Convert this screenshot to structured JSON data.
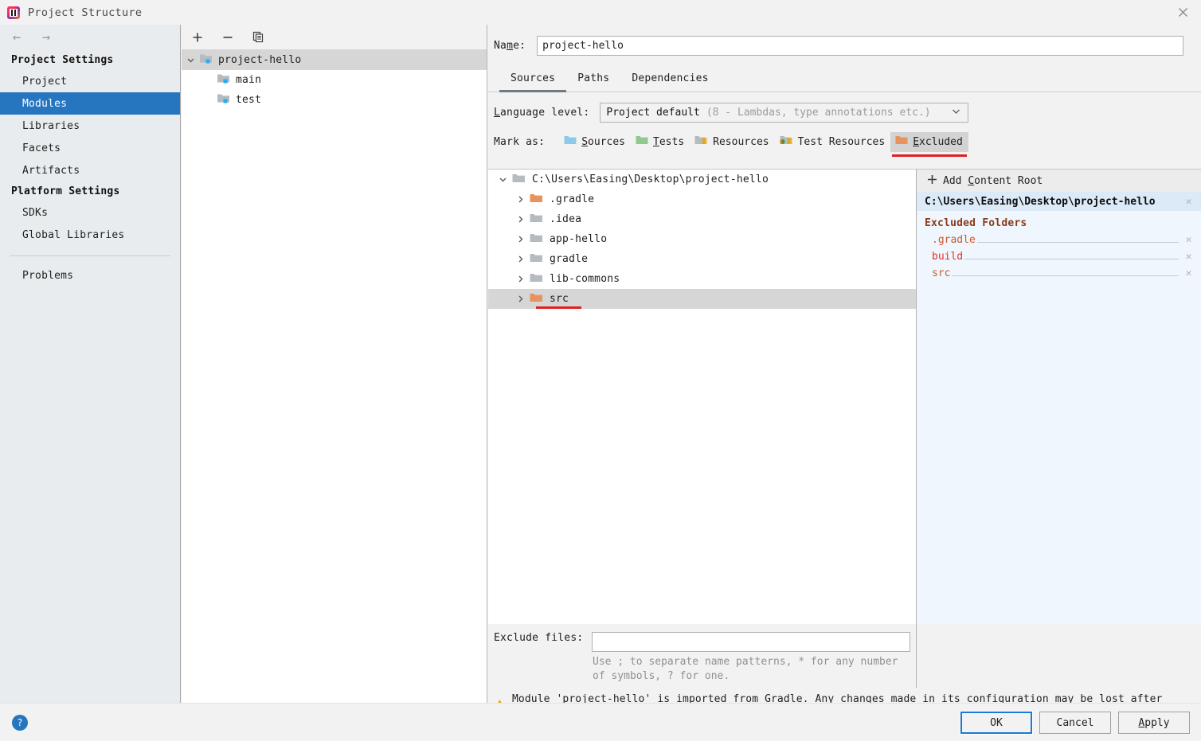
{
  "window": {
    "title": "Project Structure",
    "logo_icon": "intellij-idea-logo",
    "close_icon": "close-icon"
  },
  "sidebar": {
    "back_icon": "arrow-left-icon",
    "forward_icon": "arrow-right-icon",
    "groups": [
      {
        "title": "Project Settings",
        "items": [
          {
            "label": "Project",
            "selected": false
          },
          {
            "label": "Modules",
            "selected": true
          },
          {
            "label": "Libraries",
            "selected": false
          },
          {
            "label": "Facets",
            "selected": false
          },
          {
            "label": "Artifacts",
            "selected": false
          }
        ]
      },
      {
        "title": "Platform Settings",
        "items": [
          {
            "label": "SDKs",
            "selected": false
          },
          {
            "label": "Global Libraries",
            "selected": false
          }
        ]
      }
    ],
    "problems_label": "Problems"
  },
  "module_panel": {
    "toolbar": {
      "add_icon": "plus-icon",
      "remove_icon": "minus-icon",
      "copy_icon": "copy-icon"
    },
    "tree": [
      {
        "label": "project-hello",
        "level": 0,
        "expanded": true,
        "selected": true,
        "icon": "module-folder-icon"
      },
      {
        "label": "main",
        "level": 1,
        "expanded": false,
        "selected": false,
        "icon": "module-folder-icon"
      },
      {
        "label": "test",
        "level": 1,
        "expanded": false,
        "selected": false,
        "icon": "module-folder-icon"
      }
    ]
  },
  "detail": {
    "name_label": "Name:",
    "name_value": "project-hello",
    "tabs": [
      {
        "label": "Sources",
        "active": true
      },
      {
        "label": "Paths",
        "active": false
      },
      {
        "label": "Dependencies",
        "active": false
      }
    ],
    "language_level": {
      "label": "Language level:",
      "value": "Project default",
      "value_detail": "(8 - Lambdas, type annotations etc.)",
      "chevron_icon": "chevron-down-icon"
    },
    "mark_as": {
      "label": "Mark as:",
      "buttons": [
        {
          "label": "Sources",
          "accesskey": "S",
          "icon": "folder-sources-icon",
          "pressed": false,
          "annotated": false
        },
        {
          "label": "Tests",
          "accesskey": "T",
          "icon": "folder-tests-icon",
          "pressed": false,
          "annotated": false
        },
        {
          "label": "Resources",
          "accesskey": "",
          "icon": "folder-resources-icon",
          "pressed": false,
          "annotated": false
        },
        {
          "label": "Test Resources",
          "accesskey": "",
          "icon": "folder-test-resources-icon",
          "pressed": false,
          "annotated": false
        },
        {
          "label": "Excluded",
          "accesskey": "E",
          "icon": "folder-excluded-icon",
          "pressed": true,
          "annotated": true
        }
      ]
    },
    "content_tree": {
      "root": {
        "label": "C:\\Users\\Easing\\Desktop\\project-hello",
        "icon": "folder-gray-icon",
        "expanded": true
      },
      "children": [
        {
          "label": ".gradle",
          "icon": "folder-excluded-icon",
          "selected": false,
          "annotated": false
        },
        {
          "label": ".idea",
          "icon": "folder-gray-icon",
          "selected": false,
          "annotated": false
        },
        {
          "label": "app-hello",
          "icon": "folder-gray-icon",
          "selected": false,
          "annotated": false
        },
        {
          "label": "gradle",
          "icon": "folder-gray-icon",
          "selected": false,
          "annotated": false
        },
        {
          "label": "lib-commons",
          "icon": "folder-gray-icon",
          "selected": false,
          "annotated": false
        },
        {
          "label": "src",
          "icon": "folder-excluded-icon",
          "selected": true,
          "annotated": true
        }
      ]
    },
    "roots_panel": {
      "add_content_root_label": "Add Content Root",
      "add_icon": "plus-icon",
      "content_root": "C:\\Users\\Easing\\Desktop\\project-hello",
      "content_root_remove_icon": "close-icon",
      "excluded_header": "Excluded Folders",
      "excluded_folders": [
        {
          "label": ".gradle",
          "color": "#cc5a28"
        },
        {
          "label": "build",
          "color": "#e03030"
        },
        {
          "label": "src",
          "color": "#cc5a28"
        }
      ],
      "remove_icon": "close-icon"
    },
    "exclude_files": {
      "label": "Exclude files:",
      "value": "",
      "placeholder": "",
      "hint": "Use ; to separate name patterns, * for any number of symbols, ? for one."
    },
    "warning": {
      "icon": "warning-triangle-icon",
      "text": "Module 'project-hello' is imported from Gradle. Any changes made in its configuration may be lost after reimporting."
    }
  },
  "footer": {
    "help_icon": "help-icon",
    "buttons": [
      {
        "label": "OK",
        "focused": true,
        "accesskey": ""
      },
      {
        "label": "Cancel",
        "focused": false,
        "accesskey": ""
      },
      {
        "label": "Apply",
        "focused": false,
        "accesskey": "A"
      }
    ]
  },
  "colors": {
    "accent_blue": "#2675bf",
    "selection_gray": "#d6d6d6",
    "annotation_red": "#e02020",
    "excluded_orange": "#e8a172",
    "panel_bg": "#f2f2f2",
    "sidebar_bg": "#e9ecee",
    "roots_panel_bg": "#eff6fd"
  }
}
